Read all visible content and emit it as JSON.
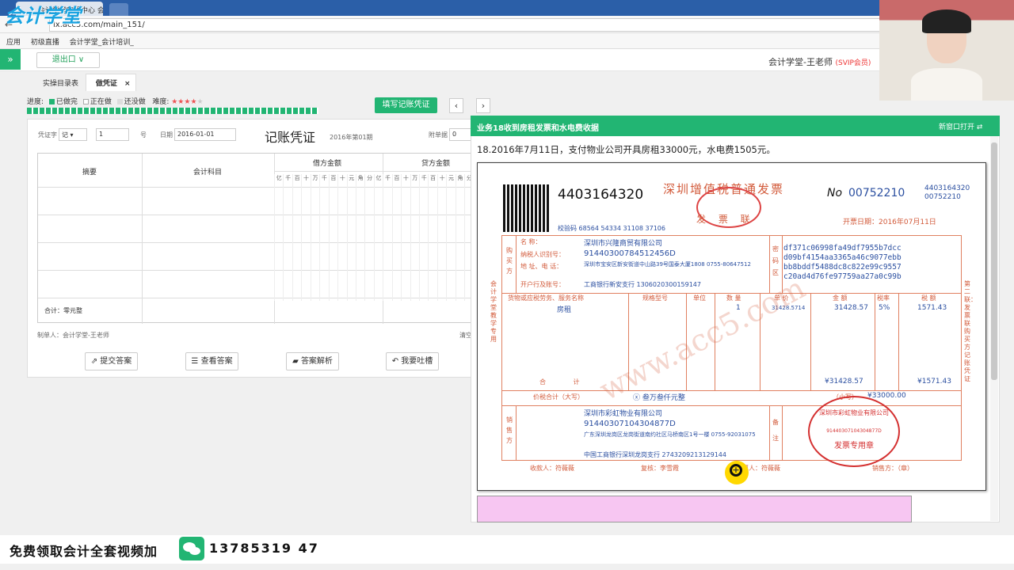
{
  "browser": {
    "tab_title": "会计学堂实操中心 会计",
    "url": "lx.acc5.com/main_151/",
    "bookmarks": [
      "应用",
      "初级直播",
      "会计学堂_会计培训_"
    ]
  },
  "logo_text": "会计学堂",
  "header": {
    "logout_label": "退出口",
    "user_name": "会计学堂-王老师",
    "user_badge": "(SVIP会员)"
  },
  "tabs": [
    "实操目录表",
    "做凭证"
  ],
  "progress": {
    "label": "进度:",
    "done": "已做完",
    "doing": "正在做",
    "todo": "还没做",
    "difficulty_label": "难度:"
  },
  "fill_button": "填写记账凭证",
  "voucher": {
    "title": "记账凭证",
    "word_label": "凭证字",
    "word_value": "记",
    "number_value": "1",
    "number_suffix": "号",
    "date_label": "日期",
    "date_value": "2016-01-01",
    "period": "2016年第01期",
    "attach_label": "附单据",
    "attach_value": "0",
    "col_summary": "摘要",
    "col_account": "会计科目",
    "col_debit": "借方金额",
    "col_credit": "贷方金额",
    "digits": [
      "亿",
      "千",
      "百",
      "十",
      "万",
      "千",
      "百",
      "十",
      "元",
      "角",
      "分"
    ],
    "total_label": "合计：零元整",
    "maker": "制单人：会计学堂-王老师",
    "clear": "清空"
  },
  "buttons": [
    "提交答案",
    "查看答案",
    "答案解析",
    "我要吐槽"
  ],
  "task": {
    "header": "业务18收到房租发票和水电费收据",
    "new_window": "新窗口打开",
    "question": "18.2016年7月11日，支付物业公司开具房租33000元，水电费1505元。"
  },
  "invoice": {
    "code_big": "4403164320",
    "title": "深圳增值税普通发票",
    "copy_label": "发 票 联",
    "no_prefix": "No",
    "no_value": "00752210",
    "code_small": "4403164320",
    "no_small": "00752210",
    "check_code": "校验码 68564 54334 31108 37106",
    "date": "开票日期：2016年07月11日",
    "buyer_side": "购买方",
    "buyer_name_label": "名 称：",
    "buyer_name": "深圳市兴隆商贸有限公司",
    "buyer_tax_label": "纳税人识别号：",
    "buyer_tax": "91440300784512456D",
    "buyer_addr_label": "地 址、电 话：",
    "buyer_addr": "深圳市宝安区新安街道中山路39号国泰大厦1808 0755-80647512",
    "buyer_bank_label": "开户行及账号：",
    "buyer_bank": "工商银行新安支行 1306020300159147",
    "cipher_side": "密码区",
    "cipher": [
      "df371c06998fa49df7955b7dcc",
      "d09bf4154aa3365a46c9077ebb",
      "bb8bddf5488dc8c822e99c9557",
      "c20ad4d76fe97759aa27a0c99b"
    ],
    "head_item": "货物或应税劳务、服务名称",
    "head_spec": "规格型号",
    "head_unit": "单位",
    "head_qty": "数 量",
    "head_price": "单 价",
    "head_amount": "金 额",
    "head_rate": "税率",
    "head_tax": "税 额",
    "item": "房租",
    "qty": "1",
    "price": "31428.5714",
    "amount": "31428.57",
    "rate": "5%",
    "tax": "1571.43",
    "total_label": "合 计",
    "total_amount": "¥31428.57",
    "total_tax": "¥1571.43",
    "grand_label": "价税合计（大写）",
    "grand_words": "ⓧ 叁万叁仟元整",
    "grand_small_label": "（小写）",
    "grand_small": "¥33000.00",
    "seller_side": "销售方",
    "seller_name": "深圳市彩虹物业有限公司",
    "seller_tax": "91440307104304877D",
    "seller_addr": "广东深圳龙岗区龙岗街道南约社区马桥南区1号一楼 0755-92031075",
    "seller_bank": "中国工商银行深圳龙岗支行 2743209213129144",
    "remark_side": "备注",
    "payee": "收款人：符薇薇",
    "review": "复核：李雪霞",
    "drawer": "开票人：符薇薇",
    "seller_stamp_label": "销售方：（章）",
    "side_left": "会计学堂教学专用",
    "side_right": "第二联：发票联 购买方记账凭证",
    "stamp1": [
      "全国统一发票监制章",
      "深圳"
    ],
    "stamp2": [
      "深圳市彩虹物业有限公司",
      "91440307104304877D",
      "发票专用章"
    ],
    "watermark": "www.acc5.com"
  },
  "footer": {
    "text": "免费领取会计全套视频加",
    "phone": "13785319 47"
  }
}
